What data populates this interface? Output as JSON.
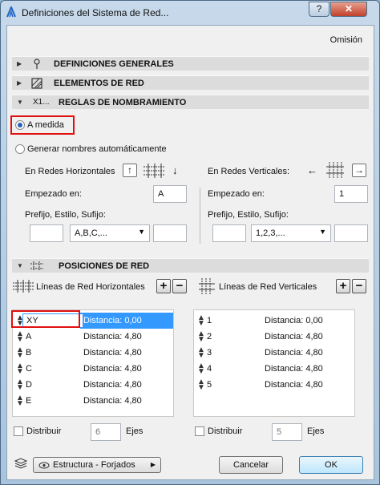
{
  "window": {
    "title": "Definiciones del Sistema de Red...",
    "help_label": "?",
    "close_label": "✕"
  },
  "header": {
    "default_label": "Omisión"
  },
  "sections": {
    "general": "DEFINICIONES GENERALES",
    "elements": "ELEMENTOS DE RED",
    "naming": "REGLAS DE NOMBRAMIENTO",
    "naming_icon_text": "X1...",
    "positions": "POSICIONES DE RED"
  },
  "naming": {
    "custom_label": "A medida",
    "auto_label": "Generar nombres automáticamente",
    "horizontal": {
      "label": "En Redes Horizontales",
      "start_label": "Empezado en:",
      "start_value": "A",
      "prefix_label": "Prefijo, Estilo, Sufijo:",
      "prefix_value": "",
      "style_value": "A,B,C,...",
      "suffix_value": ""
    },
    "vertical": {
      "label": "En Redes Verticales:",
      "start_label": "Empezado en:",
      "start_value": "1",
      "prefix_label": "Prefijo, Estilo, Sufijo:",
      "prefix_value": "",
      "style_value": "1,2,3,...",
      "suffix_value": ""
    }
  },
  "positions": {
    "horizontal": {
      "label": "Líneas de Red Horizontales",
      "rows": [
        {
          "name": "XY",
          "distance": "Distancia: 0,00"
        },
        {
          "name": "A",
          "distance": "Distancia: 4,80"
        },
        {
          "name": "B",
          "distance": "Distancia: 4,80"
        },
        {
          "name": "C",
          "distance": "Distancia: 4,80"
        },
        {
          "name": "D",
          "distance": "Distancia: 4,80"
        },
        {
          "name": "E",
          "distance": "Distancia: 4,80"
        }
      ],
      "distribute_label": "Distribuir",
      "axes_value": "6",
      "axes_label": "Ejes"
    },
    "vertical": {
      "label": "Líneas de Red Verticales",
      "rows": [
        {
          "name": "1",
          "distance": "Distancia: 0,00"
        },
        {
          "name": "2",
          "distance": "Distancia: 4,80"
        },
        {
          "name": "3",
          "distance": "Distancia: 4,80"
        },
        {
          "name": "4",
          "distance": "Distancia: 4,80"
        },
        {
          "name": "5",
          "distance": "Distancia: 4,80"
        }
      ],
      "distribute_label": "Distribuir",
      "axes_value": "5",
      "axes_label": "Ejes"
    }
  },
  "footer": {
    "layer_value": "Estructura - Forjados",
    "cancel_label": "Cancelar",
    "ok_label": "OK"
  },
  "colors": {
    "highlight": "#e01010",
    "selection": "#3399ff"
  }
}
